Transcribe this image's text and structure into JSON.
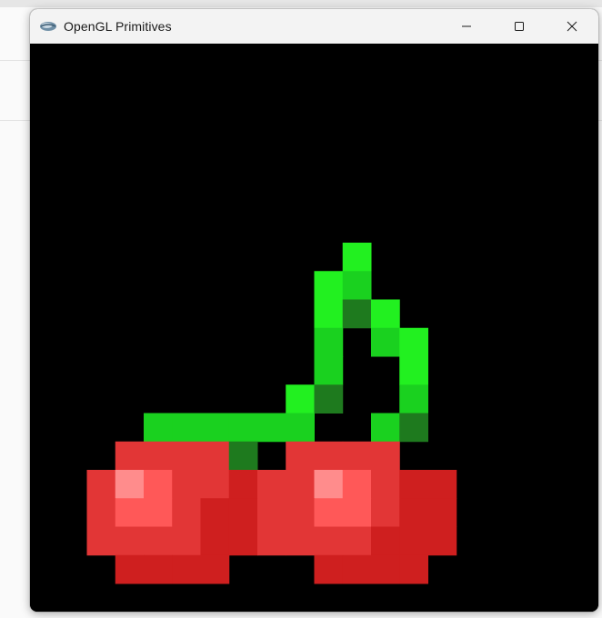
{
  "window": {
    "title": "OpenGL Primitives",
    "controls": {
      "minimize_icon": "minimize-icon",
      "maximize_icon": "maximize-icon",
      "close_icon": "close-icon"
    }
  },
  "canvas": {
    "background": "#000000",
    "content": "pixel-art cherries",
    "palette": {
      "g": "#22f020",
      "G": "#1ad11f",
      "d": "#1e7a1e",
      "r": "#e23636",
      "R": "#cf1f1f",
      "p": "#ff5858",
      "w": "#ff8c8c"
    },
    "pixel_rows": [
      "...........g.....",
      "..........gG.....",
      "..........gdg....",
      "..........G.Gg...",
      "..........G..g...",
      ".........gd..G...",
      "....GGGGGG..Gd...",
      "...rrrrd.rrrr....",
      "..rwprrRrrwprRR..",
      "..rpprRRrrpprRR..",
      "..rrrrRRrrrrRRR..",
      "...RRRR...RRRR..."
    ]
  }
}
